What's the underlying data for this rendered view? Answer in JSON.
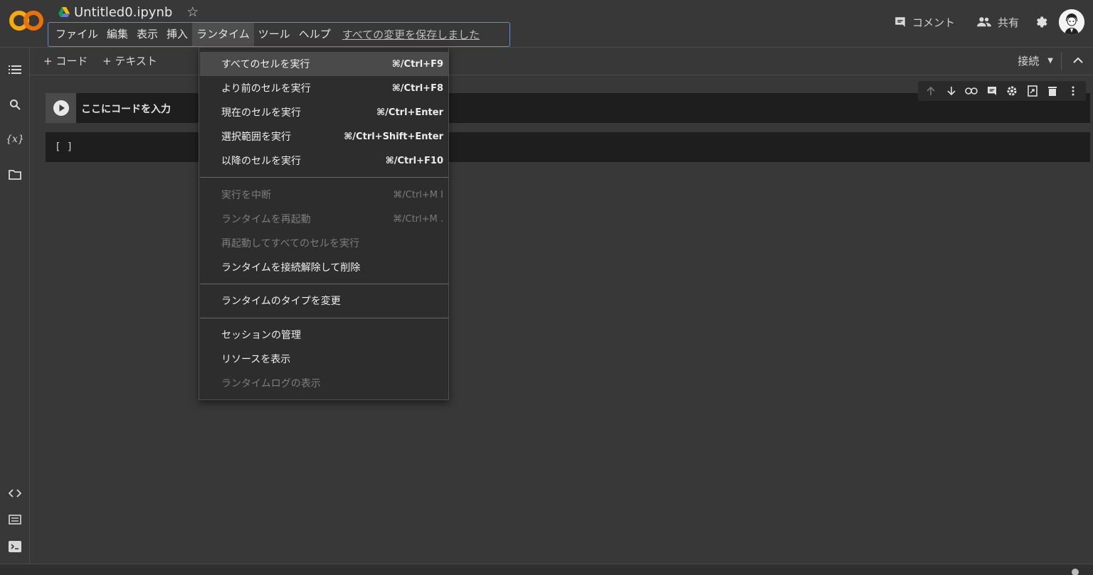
{
  "header": {
    "title": "Untitled0.ipynb",
    "save_status": "すべての変更を保存しました",
    "comment_label": "コメント",
    "share_label": "共有",
    "menu": [
      {
        "label": "ファイル"
      },
      {
        "label": "編集"
      },
      {
        "label": "表示"
      },
      {
        "label": "挿入"
      },
      {
        "label": "ランタイム",
        "active": true
      },
      {
        "label": "ツール"
      },
      {
        "label": "ヘルプ"
      }
    ]
  },
  "toolbar": {
    "add_code_label": "+ コード",
    "add_text_label": "+ テキスト",
    "connect_label": "接続"
  },
  "cell": {
    "placeholder": "ここにコードを入力",
    "output_prompt": "[ ]"
  },
  "runtime_menu": {
    "items": [
      {
        "label": "すべてのセルを実行",
        "shortcut": "⌘/Ctrl+F9",
        "enabled": true,
        "highlighted": true
      },
      {
        "label": "より前のセルを実行",
        "shortcut": "⌘/Ctrl+F8",
        "enabled": true
      },
      {
        "label": "現在のセルを実行",
        "shortcut": "⌘/Ctrl+Enter",
        "enabled": true
      },
      {
        "label": "選択範囲を実行",
        "shortcut": "⌘/Ctrl+Shift+Enter",
        "enabled": true
      },
      {
        "label": "以降のセルを実行",
        "shortcut": "⌘/Ctrl+F10",
        "enabled": true
      },
      {
        "label": "実行を中断",
        "shortcut": "⌘/Ctrl+M I",
        "enabled": false
      },
      {
        "label": "ランタイムを再起動",
        "shortcut": "⌘/Ctrl+M .",
        "enabled": false
      },
      {
        "label": "再起動してすべてのセルを実行",
        "shortcut": "",
        "enabled": false
      },
      {
        "label": "ランタイムを接続解除して削除",
        "shortcut": "",
        "enabled": true
      },
      {
        "label": "ランタイムのタイプを変更",
        "shortcut": "",
        "enabled": true
      },
      {
        "label": "セッションの管理",
        "shortcut": "",
        "enabled": true
      },
      {
        "label": "リソースを表示",
        "shortcut": "",
        "enabled": true
      },
      {
        "label": "ランタイムログの表示",
        "shortcut": "",
        "enabled": false
      }
    ]
  },
  "icons": {
    "left_rail": [
      "toc-icon",
      "search-icon",
      "variables-icon",
      "folder-icon",
      "code-snippets-icon",
      "command-palette-icon",
      "terminal-icon"
    ],
    "cell_toolbar": [
      "move-up-icon",
      "move-down-icon",
      "link-icon",
      "comment-icon",
      "settings-icon",
      "mirror-cell-icon",
      "delete-icon",
      "more-icon"
    ]
  },
  "colors": {
    "background": "#383838",
    "cell_background": "#1e1e1e",
    "menu_background": "#2d2d2d",
    "focus_border": "#5b8fd6",
    "logo_orange": "#f9ab00"
  }
}
